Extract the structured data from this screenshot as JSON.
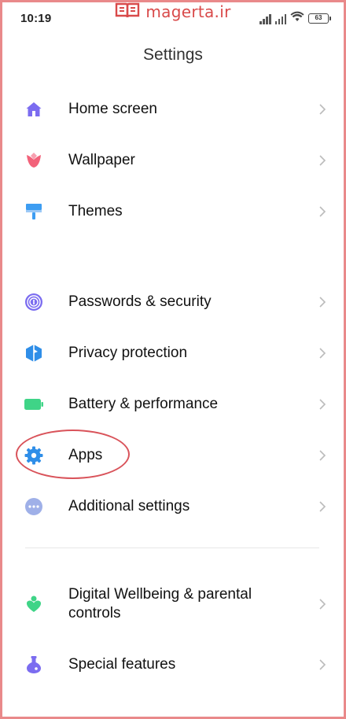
{
  "status_bar": {
    "time": "10:19",
    "battery": "63"
  },
  "watermark": {
    "text": "magerta.ir",
    "color": "#d94a4a"
  },
  "header": {
    "title": "Settings"
  },
  "sections": [
    {
      "items": [
        {
          "label": "Home screen",
          "icon": "home-icon",
          "color": "#7b6cf0"
        },
        {
          "label": "Wallpaper",
          "icon": "tulip-icon",
          "color": "#f2627a"
        },
        {
          "label": "Themes",
          "icon": "paint-roller-icon",
          "color": "#3d9df2"
        }
      ]
    },
    {
      "items": [
        {
          "label": "Passwords & security",
          "icon": "fingerprint-icon",
          "color": "#7b6cf0"
        },
        {
          "label": "Privacy protection",
          "icon": "shield-icon",
          "color": "#2f8ee8"
        },
        {
          "label": "Battery & performance",
          "icon": "battery-icon",
          "color": "#3fd487"
        },
        {
          "label": "Apps",
          "icon": "gear-icon",
          "color": "#2f8ee8",
          "highlighted": true
        },
        {
          "label": "Additional settings",
          "icon": "more-dots-icon",
          "color": "#9fb0e8"
        }
      ]
    },
    {
      "items": [
        {
          "label": "Digital Wellbeing & parental controls",
          "icon": "wellbeing-icon",
          "color": "#3fd487"
        },
        {
          "label": "Special features",
          "icon": "flask-icon",
          "color": "#7b6cf0"
        }
      ]
    }
  ],
  "colors": {
    "highlight_ring": "#d9535a",
    "frame": "#e9898a",
    "chevron": "#bbbbbb"
  }
}
